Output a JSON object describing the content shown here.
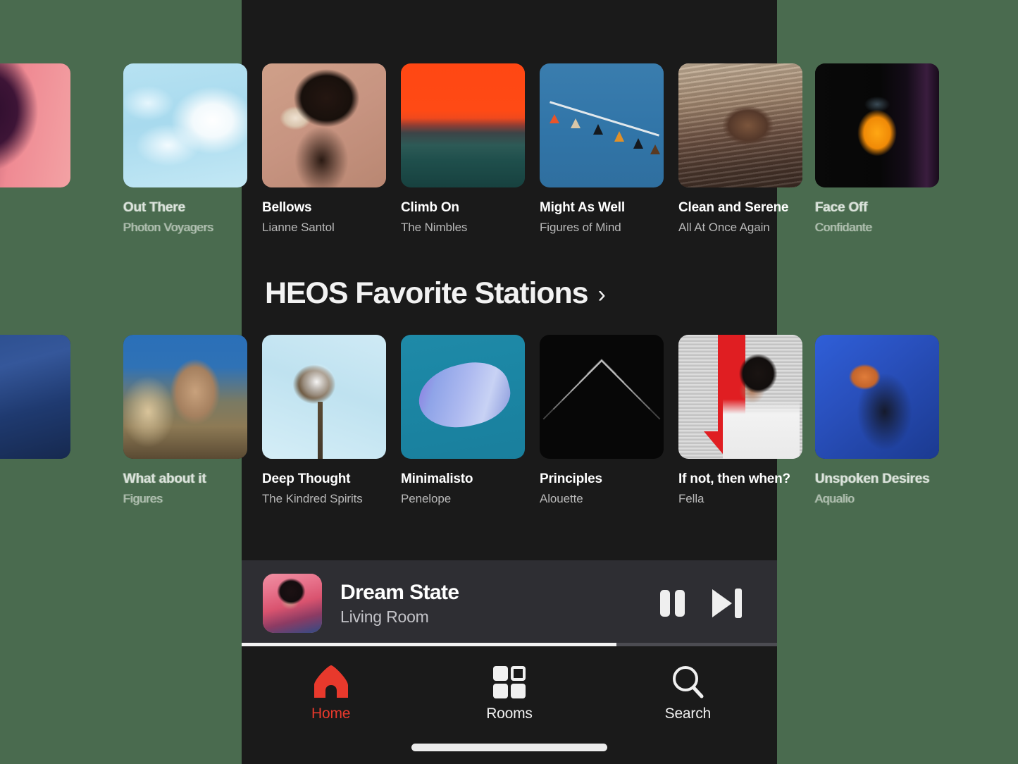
{
  "app": {
    "background_color": "#4a6b4f",
    "frame_background": "#1a1a1a"
  },
  "sections": [
    {
      "id": "row-top",
      "header": null,
      "tiles": [
        {
          "title": "",
          "subtitle": "",
          "art": "a-pinkpurple",
          "partial": true
        },
        {
          "title": "Out There",
          "subtitle": "Photon Voyagers",
          "art": "a-clouds"
        },
        {
          "title": "Bellows",
          "subtitle": "Lianne Santol",
          "art": "a-portrait"
        },
        {
          "title": "Climb On",
          "subtitle": "The Nimbles",
          "art": "a-sunset"
        },
        {
          "title": "Might As Well",
          "subtitle": "Figures of Mind",
          "art": "a-flags"
        },
        {
          "title": "Clean and Serene",
          "subtitle": "All At Once Again",
          "art": "a-water"
        },
        {
          "title": "Face Off",
          "subtitle": "Confidante",
          "art": "a-bird"
        }
      ]
    },
    {
      "id": "row-heos",
      "header": {
        "title": "HEOS Favorite Stations",
        "chevron": "›"
      },
      "tiles": [
        {
          "title": "",
          "subtitle": "",
          "art": "a-blueperson",
          "partial": true
        },
        {
          "title": "What about it",
          "subtitle": "Figures",
          "art": "a-fieldgirl"
        },
        {
          "title": "Deep Thought",
          "subtitle": "The Kindred Spirits",
          "art": "a-palm"
        },
        {
          "title": "Minimalisto",
          "subtitle": "Penelope",
          "art": "a-shark"
        },
        {
          "title": "Principles",
          "subtitle": "Alouette",
          "art": "a-chevrons"
        },
        {
          "title": "If not, then when?",
          "subtitle": "Fella",
          "art": "a-redarrow"
        },
        {
          "title": "Unspoken Desires",
          "subtitle": "Aqualio",
          "art": "a-blueball"
        }
      ]
    }
  ],
  "now_playing": {
    "track_title": "Dream State",
    "room": "Living Room",
    "artwork": "a-dreamstate",
    "pause_label": "Pause",
    "next_label": "Next track",
    "progress_percent": 70
  },
  "tab_bar": {
    "items": [
      {
        "label": "Home",
        "icon": "home-icon",
        "active": true,
        "color": "#e8392c"
      },
      {
        "label": "Rooms",
        "icon": "rooms-grid-icon",
        "active": false
      },
      {
        "label": "Search",
        "icon": "search-icon",
        "active": false
      }
    ]
  }
}
